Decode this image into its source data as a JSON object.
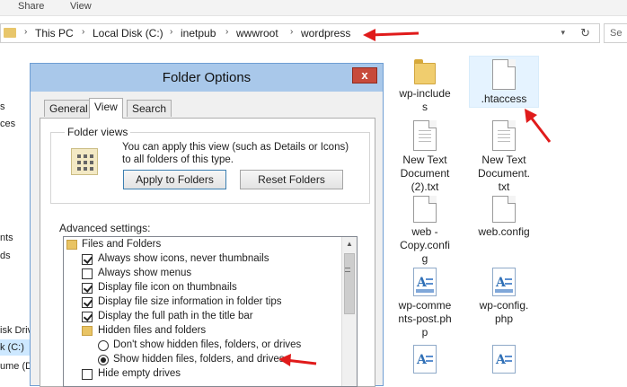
{
  "ribbon": {
    "share": "Share",
    "view": "View"
  },
  "address": {
    "crumbs": [
      "This PC",
      "Local Disk (C:)",
      "inetpub",
      "wwwroot",
      "wordpress"
    ]
  },
  "nav": [
    "s",
    "ces",
    "nts",
    "ds",
    "isk Driv",
    "k (C:)",
    "ume (D"
  ],
  "files": [
    {
      "label_lines": [
        "wp-include",
        "s"
      ]
    },
    {
      "label_lines": [
        ".htaccess"
      ]
    },
    {
      "label_lines": [
        "New Text",
        "Document",
        "(2).txt"
      ]
    },
    {
      "label_lines": [
        "New Text",
        "Document.",
        "txt"
      ]
    },
    {
      "label_lines": [
        "web -",
        "Copy.confi",
        "g"
      ]
    },
    {
      "label_lines": [
        "web.config"
      ]
    },
    {
      "label_lines": [
        "wp-comme",
        "nts-post.ph",
        "p"
      ]
    },
    {
      "label_lines": [
        "wp-config.",
        "php"
      ]
    }
  ],
  "dialog": {
    "title": "Folder Options",
    "close": "x",
    "tabs": [
      "General",
      "View",
      "Search"
    ],
    "folder_views": {
      "label": "Folder views",
      "text": "You can apply this view (such as Details or Icons) to all folders of this type.",
      "apply": "Apply to Folders",
      "reset": "Reset Folders"
    },
    "advanced_label": "Advanced settings:",
    "tree": [
      {
        "kind": "folder",
        "text": "Files and Folders"
      },
      {
        "kind": "check",
        "checked": true,
        "text": "Always show icons, never thumbnails"
      },
      {
        "kind": "check",
        "checked": false,
        "text": "Always show menus"
      },
      {
        "kind": "check",
        "checked": true,
        "text": "Display file icon on thumbnails"
      },
      {
        "kind": "check",
        "checked": true,
        "text": "Display file size information in folder tips"
      },
      {
        "kind": "check",
        "checked": true,
        "text": "Display the full path in the title bar"
      },
      {
        "kind": "folder",
        "text": "Hidden files and folders"
      },
      {
        "kind": "radio",
        "checked": false,
        "text": "Don't show hidden files, folders, or drives"
      },
      {
        "kind": "radio",
        "checked": true,
        "text": "Show hidden files, folders, and drives"
      },
      {
        "kind": "check",
        "checked": false,
        "text": "Hide empty drives"
      }
    ]
  },
  "colors": {
    "arrow": "#e01b1b",
    "accent": "#3c7fb1",
    "folder": "#f0cd6e"
  }
}
